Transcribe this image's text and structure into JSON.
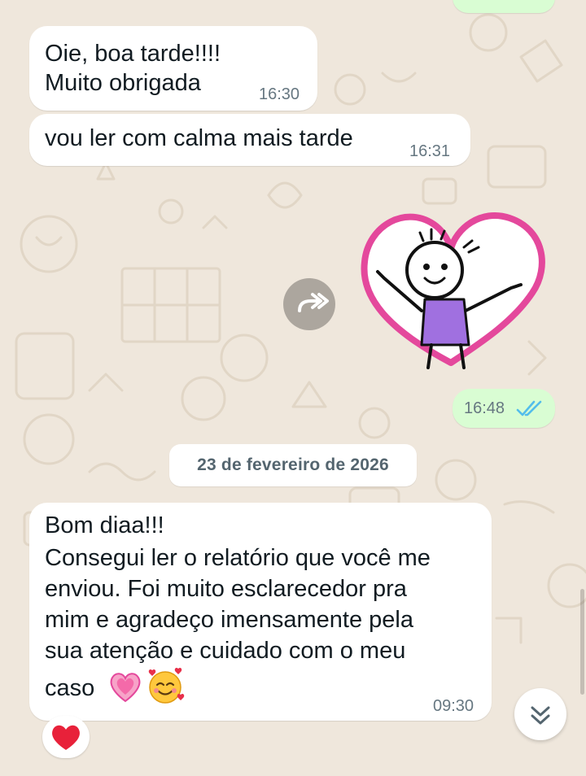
{
  "messages": [
    {
      "direction": "incoming",
      "lines": [
        "Oie, boa tarde!!!!",
        "Muito obrigada"
      ],
      "time": "16:30"
    },
    {
      "direction": "incoming",
      "lines": [
        "vou ler com calma mais tarde"
      ],
      "time": "16:31"
    },
    {
      "direction": "outgoing",
      "type": "sticker",
      "sticker_description": "stick-figure-in-pink-heart",
      "time": "16:48",
      "status": "read"
    },
    {
      "direction": "incoming",
      "lines": [
        "Bom diaa!!!",
        "Consegui ler o relatório que você me",
        "enviou. Foi muito esclarecedor pra",
        "mim e agradeço imensamente pela",
        "sua atenção e cuidado com o meu",
        "caso"
      ],
      "emojis": [
        "growing-heart-emoji",
        "smiling-face-with-hearts-emoji"
      ],
      "time": "09:30",
      "reaction": "red-heart-emoji"
    }
  ],
  "date_separator": "23 de fevereiro de 2026",
  "icons": {
    "forward": "forward-icon",
    "read_receipt": "double-check-icon",
    "scroll_down": "double-chevron-down-icon"
  },
  "colors": {
    "wallpaper": "#efe7dc",
    "incoming_bubble": "#ffffff",
    "outgoing_bubble": "#d9fdd3",
    "read_ticks": "#53bdeb",
    "heart_outline": "#e4489c",
    "shirt": "#a070e0"
  }
}
